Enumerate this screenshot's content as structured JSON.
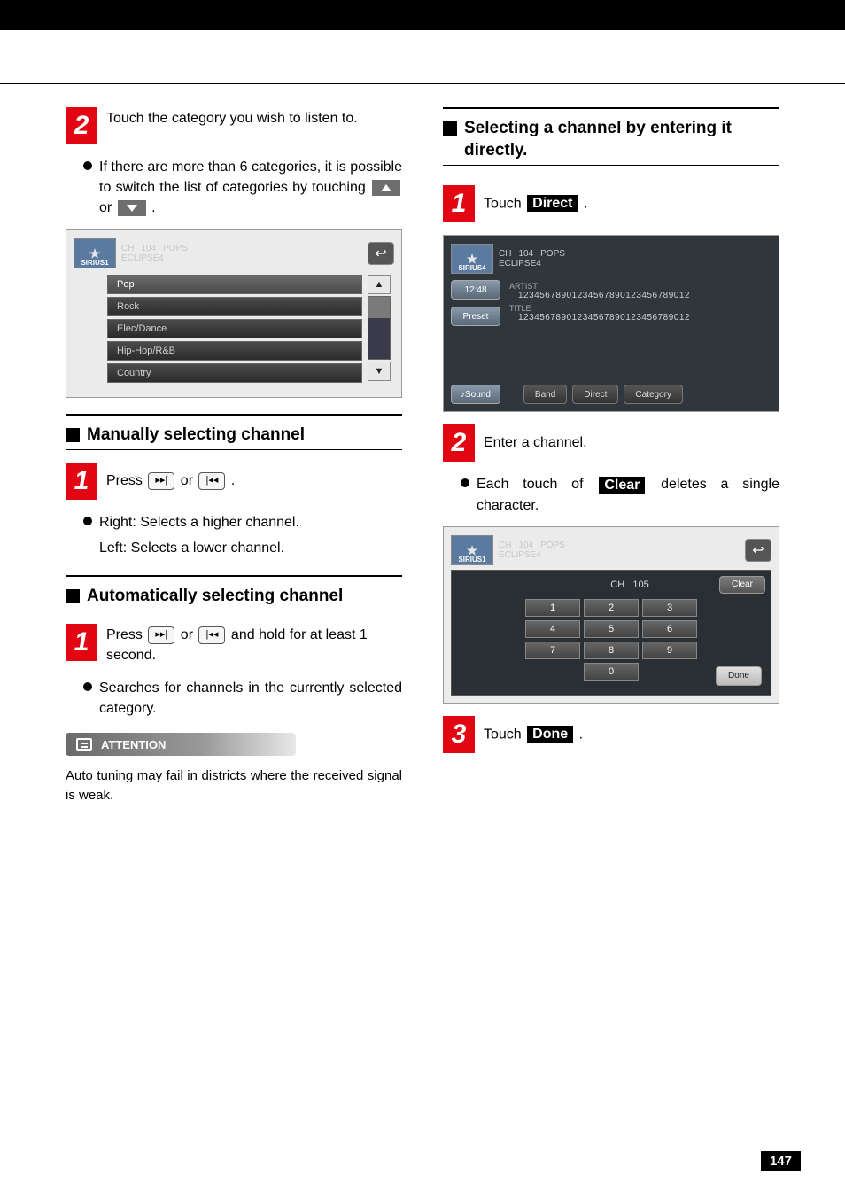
{
  "left": {
    "step2_text": "Touch the category you wish to listen to.",
    "bullet1_a": "If there are more than 6 categories, it is possible to switch the list of categories by touching ",
    "bullet1_b": " or ",
    "bullet1_c": ".",
    "scr1": {
      "logo": "SIRIUS1",
      "ch_label": "CH",
      "ch": "104",
      "cat": "POPS",
      "sub": "ECLIPSE4",
      "items": [
        "Pop",
        "Rock",
        "Elec/Dance",
        "Hip-Hop/R&B",
        "Country"
      ]
    },
    "sec_manual": "Manually selecting channel",
    "manual_step1_a": "Press ",
    "manual_step1_b": " or ",
    "manual_step1_c": ".",
    "manual_bullet_r": "Right: Selects a higher channel.",
    "manual_bullet_l": "Left: Selects a lower channel.",
    "sec_auto": "Automatically selecting channel",
    "auto_step1_a": "Press ",
    "auto_step1_b": " or ",
    "auto_step1_c": " and hold for at least 1 second.",
    "auto_bullet": "Searches for channels in the currently selected category.",
    "attention_label": "ATTENTION",
    "attention_text": "Auto tuning may fail in districts where the received signal is weak."
  },
  "right": {
    "sec_direct": "Selecting a channel by entering it directly.",
    "step1_a": "Touch ",
    "step1_btn": "Direct",
    "step1_b": ".",
    "scr2": {
      "logo": "SIRIUS4",
      "ch_label": "CH",
      "ch": "104",
      "cat": "POPS",
      "sub": "ECLIPSE4",
      "time": "12:48",
      "preset": "Preset",
      "artist_label": "ARTIST",
      "artist": "12345678901234567890123456789012",
      "title_label": "TITLE",
      "title": "12345678901234567890123456789012",
      "sound": "♪Sound",
      "band": "Band",
      "direct": "Direct",
      "category": "Category"
    },
    "step2_text": "Enter a channel.",
    "bullet2_a": "Each touch of ",
    "bullet2_btn": "Clear",
    "bullet2_b": " deletes a single character.",
    "scr3": {
      "logo": "SIRIUS1",
      "ch_label": "CH",
      "ch": "104",
      "cat": "POPS",
      "sub": "ECLIPSE4",
      "display_ch_label": "CH",
      "display_ch": "105",
      "clear": "Clear",
      "keys": [
        [
          "1",
          "2",
          "3"
        ],
        [
          "4",
          "5",
          "6"
        ],
        [
          "7",
          "8",
          "9"
        ],
        [
          "0"
        ]
      ],
      "done": "Done"
    },
    "step3_a": "Touch ",
    "step3_btn": "Done",
    "step3_b": "."
  },
  "page_number": "147"
}
